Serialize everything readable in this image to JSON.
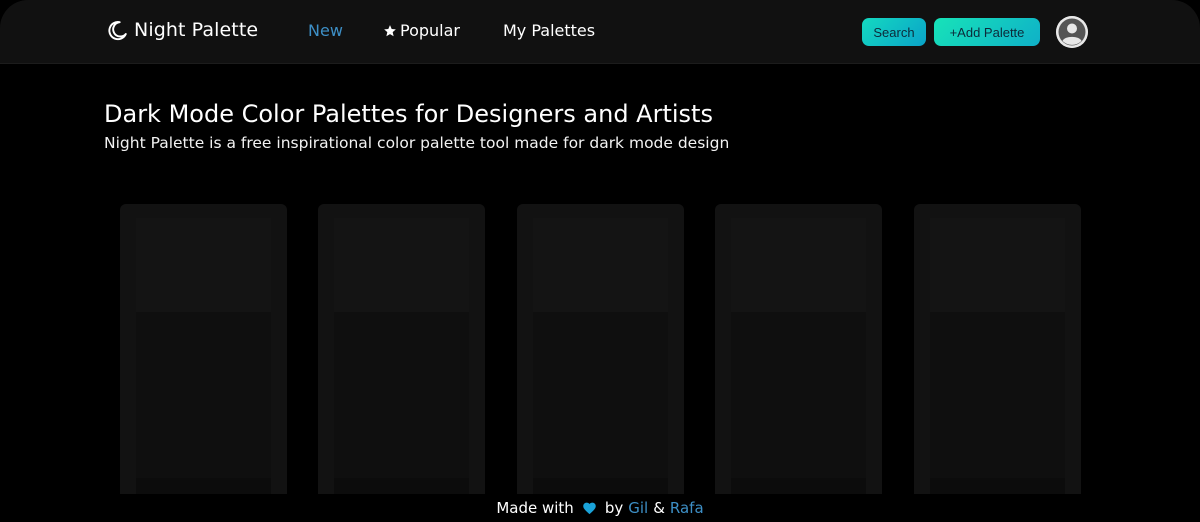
{
  "header": {
    "logo_text": "Night Palette",
    "nav": {
      "new": "New",
      "popular": "Popular",
      "my_palettes": "My Palettes"
    },
    "search_label": "Search",
    "add_label": "+Add Palette"
  },
  "hero": {
    "title": "Dark Mode Color Palettes for Designers and Artists",
    "subtitle": "Night Palette is a free inspirational color palette tool made for dark mode design"
  },
  "footer": {
    "made_with": "Made with",
    "by": "by",
    "author1": "Gil",
    "amp": "&",
    "author2": "Rafa"
  },
  "colors": {
    "accent": "#3d8fc6",
    "heart": "#1aa3d9",
    "header_bg": "#111111"
  },
  "icons": [
    "moon-icon",
    "star-icon",
    "user-avatar-icon",
    "heart-icon"
  ]
}
